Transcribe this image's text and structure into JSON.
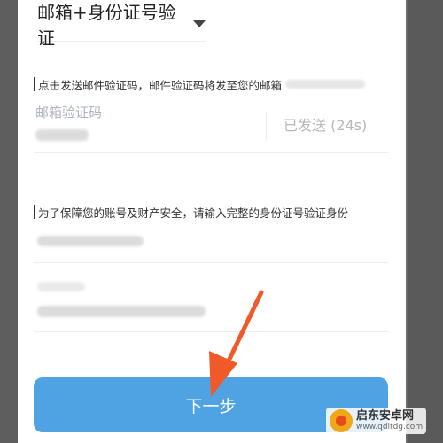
{
  "verify_method": {
    "label": "邮箱+身份证号验证"
  },
  "email_section": {
    "notice": "点击发送邮件验证码，邮件验证码将发至您的邮箱",
    "code_label": "邮箱验证码",
    "send_status": "已发送 (24s)"
  },
  "id_section": {
    "notice": "为了保障您的账号及财产安全，请输入完整的身份证号验证身份"
  },
  "next_button": {
    "label": "下一步"
  },
  "watermark": {
    "title": "启东安卓网",
    "url": "www.qdltdg.com"
  },
  "colors": {
    "button": "#4fa3e2",
    "arrow": "#f05a28"
  }
}
